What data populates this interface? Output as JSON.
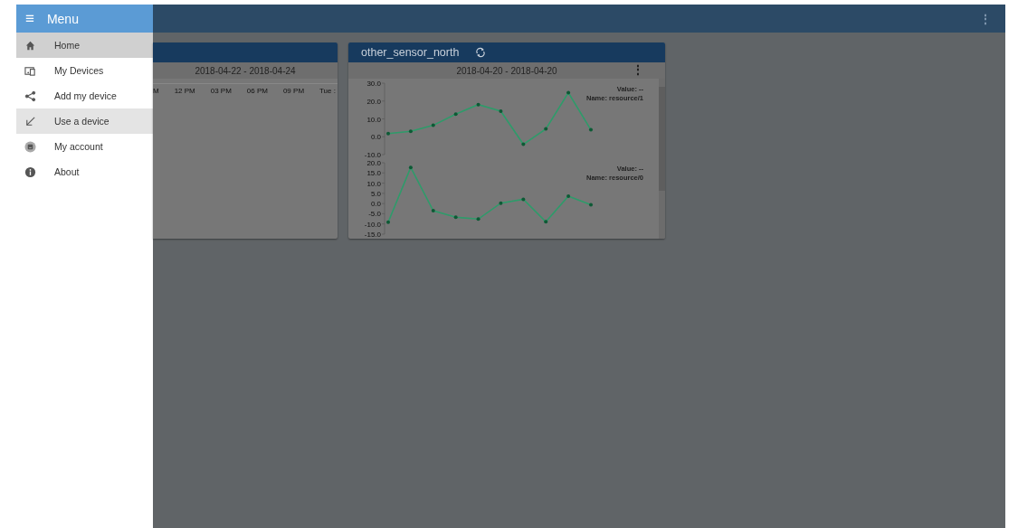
{
  "app_bar": {
    "more_icon": "⋮"
  },
  "menu": {
    "icon": "≡",
    "title": "Menu",
    "items": [
      {
        "label": "Home",
        "kind": "home",
        "selected": true,
        "hovered": false
      },
      {
        "label": "My Devices",
        "kind": "devices",
        "selected": false,
        "hovered": false
      },
      {
        "label": "Add my device",
        "kind": "share",
        "selected": false,
        "hovered": false
      },
      {
        "label": "Use a device",
        "kind": "import",
        "selected": false,
        "hovered": true
      },
      {
        "label": "My account",
        "kind": "account",
        "selected": false,
        "hovered": false
      },
      {
        "label": "About",
        "kind": "info",
        "selected": false,
        "hovered": false
      }
    ]
  },
  "cards": [
    {
      "date_range": "2018-04-22 - 2018-04-24",
      "time_axis": [
        "M",
        "12 PM",
        "03 PM",
        "06 PM",
        "09 PM",
        "Tue :"
      ]
    },
    {
      "title": "other_sensor_north",
      "date_range": "2018-04-20 - 2018-04-20",
      "more_icon": "⋮",
      "charts": [
        {
          "value_label": "Value: --",
          "name_label": "Name:",
          "chart_data": {
            "type": "line",
            "categories": [
              null,
              null,
              null,
              null,
              null,
              null,
              null,
              null,
              null,
              null
            ],
            "ylim": [
              -10,
              30
            ],
            "yticks": [
              {
                "value": 30,
                "label": "30.0"
              },
              {
                "value": 20,
                "label": "20.0"
              },
              {
                "value": 10,
                "label": "10.0"
              },
              {
                "value": 0,
                "label": "0.0"
              },
              {
                "value": -10,
                "label": "-10.0"
              }
            ],
            "series": [
              {
                "name": "resource/1",
                "color": "#2e9b6a",
                "values": [
                  1.8,
                  3.0,
                  6.4,
                  12.7,
                  18.0,
                  14.3,
                  -4.2,
                  4.4,
                  24.7,
                  3.9
                ]
              }
            ]
          }
        },
        {
          "value_label": "Value: --",
          "name_label": "Name:",
          "chart_data": {
            "type": "line",
            "categories": [
              null,
              null,
              null,
              null,
              null,
              null,
              null,
              null,
              null,
              null
            ],
            "ylim": [
              -15,
              20
            ],
            "yticks": [
              {
                "value": 20,
                "label": "20.0"
              },
              {
                "value": 15,
                "label": "15.0"
              },
              {
                "value": 10,
                "label": "10.0"
              },
              {
                "value": 5,
                "label": "5.0"
              },
              {
                "value": 0,
                "label": "0.0"
              },
              {
                "value": -5,
                "label": "-5.0"
              },
              {
                "value": -10,
                "label": "-10.0"
              },
              {
                "value": -15,
                "label": "-15.0"
              }
            ],
            "series": [
              {
                "name": "resource/0",
                "color": "#2e9b6a",
                "values": [
                  -9.1,
                  17.7,
                  -3.5,
                  -6.7,
                  -7.6,
                  0.2,
                  2.1,
                  -8.9,
                  3.6,
                  -0.6
                ]
              }
            ]
          }
        }
      ]
    }
  ]
}
